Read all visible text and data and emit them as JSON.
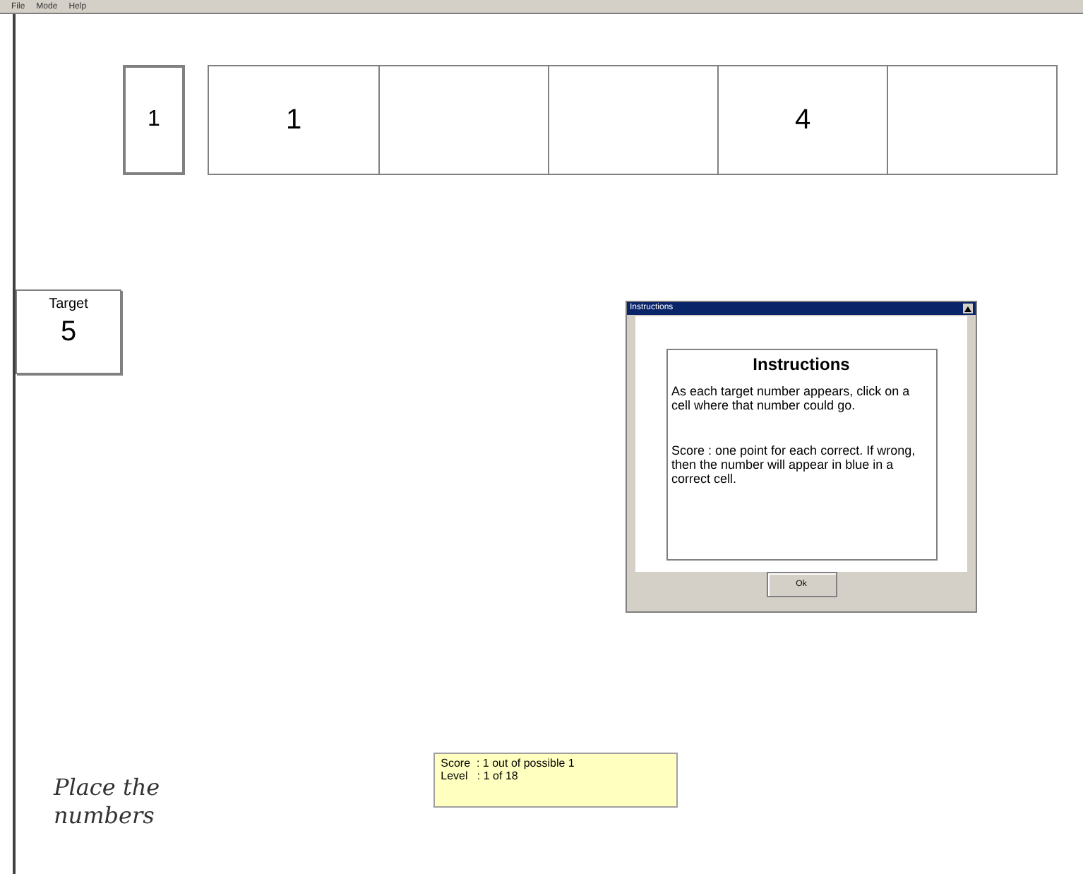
{
  "menu": [
    "File",
    "Mode",
    "Help"
  ],
  "current": "1",
  "cells": [
    {
      "value": "1"
    },
    {},
    {},
    {
      "value": "4"
    },
    {}
  ],
  "target": {
    "label": "Target",
    "value": "5"
  },
  "dialog": {
    "title": "Instructions",
    "heading": "Instructions",
    "paragraphs": [
      "As each target number appears, click on a cell where that number could go.",
      "Score : one point for each correct. If wrong, then the number will appear in blue in a correct cell."
    ],
    "button": "Ok"
  },
  "caption": [
    "Place the",
    "numbers"
  ],
  "status": [
    "Score  : 1 out of possible 1",
    "Level   : 1 of 18"
  ]
}
